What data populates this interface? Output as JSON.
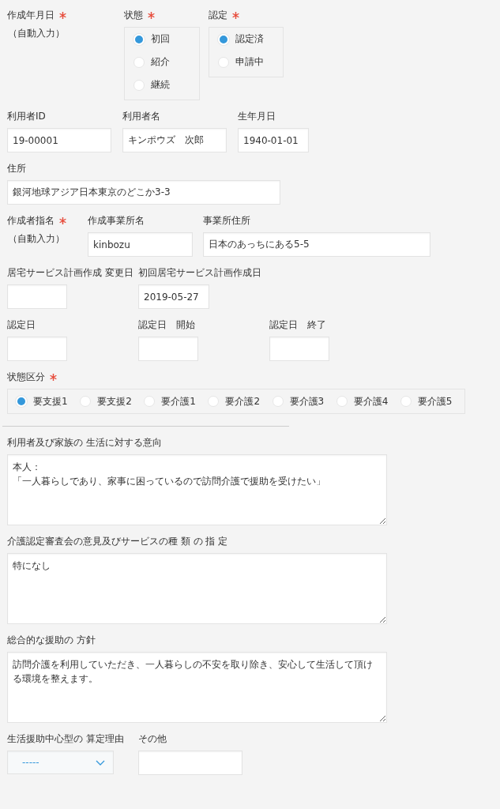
{
  "rows": [
    {
      "fields": [
        {
          "kind": "auto",
          "label": "作成年月日",
          "required": true,
          "value": "（自動入力）"
        },
        {
          "kind": "radio",
          "label": "状態",
          "required": true,
          "options": [
            {
              "label": "初回",
              "selected": true
            },
            {
              "label": "紹介",
              "selected": false
            },
            {
              "label": "継続",
              "selected": false
            }
          ]
        },
        {
          "kind": "radio",
          "label": "認定",
          "required": true,
          "options": [
            {
              "label": "認定済",
              "selected": true
            },
            {
              "label": "申請中",
              "selected": false
            }
          ]
        }
      ]
    },
    {
      "fields": [
        {
          "kind": "text",
          "label": "利用者ID",
          "required": false,
          "value": "19-00001"
        },
        {
          "kind": "text",
          "label": "利用者名",
          "required": false,
          "value": "キンポウズ　次郎"
        },
        {
          "kind": "text",
          "label": "生年月日",
          "required": false,
          "value": "1940-01-01"
        }
      ]
    },
    {
      "fields": [
        {
          "kind": "text",
          "label": "住所",
          "required": false,
          "value": "銀河地球アジア日本東京のどこか3-3"
        }
      ]
    },
    {
      "fields": [
        {
          "kind": "auto",
          "label": "作成者指名",
          "required": true,
          "value": "（自動入力）"
        },
        {
          "kind": "text",
          "label": "作成事業所名",
          "required": false,
          "value": "kinbozu"
        },
        {
          "kind": "text",
          "label": "事業所住所",
          "required": false,
          "value": "日本のあっちにある5-5"
        }
      ]
    },
    {
      "fields": [
        {
          "kind": "text",
          "label": "居宅サービス計画作成 変更日",
          "required": false
        },
        {
          "kind": "text",
          "label": "初回居宅サービス計画作成日",
          "required": false,
          "value": "2019-05-27"
        }
      ]
    },
    {
      "fields": [
        {
          "kind": "text",
          "label": "認定日",
          "required": false
        },
        {
          "kind": "text",
          "label": "認定日　開始",
          "required": false
        },
        {
          "kind": "text",
          "label": "認定日　終了",
          "required": false
        }
      ]
    },
    {
      "fields": [
        {
          "kind": "radio-inline",
          "label": "状態区分",
          "required": true,
          "options": [
            {
              "label": "要支援1",
              "selected": true
            },
            {
              "label": "要支援2",
              "selected": false
            },
            {
              "label": "要介護1",
              "selected": false
            },
            {
              "label": "要介護2",
              "selected": false
            },
            {
              "label": "要介護3",
              "selected": false
            },
            {
              "label": "要介護4",
              "selected": false
            },
            {
              "label": "要介護5",
              "selected": false
            }
          ]
        }
      ]
    },
    {
      "fields": [
        {
          "kind": "divider"
        }
      ]
    },
    {
      "fields": [
        {
          "kind": "textarea",
          "label": "利用者及び家族の 生活に対する意向",
          "required": false,
          "lines": [
            "本人：",
            "「一人暮らしであり、家事に困っているので訪問介護で援助を受けたい」"
          ]
        }
      ]
    },
    {
      "fields": [
        {
          "kind": "textarea",
          "label": "介護認定審査会の意見及びサービスの種 類 の 指 定",
          "required": false,
          "value": "特になし"
        }
      ]
    },
    {
      "fields": [
        {
          "kind": "textarea",
          "label": "総合的な援助の 方針",
          "required": false,
          "value": "訪問介護を利用していただき、一人暮らしの不安を取り除き、安心して生活して頂ける環境を整えます。"
        }
      ]
    },
    {
      "fields": [
        {
          "kind": "select",
          "label": "生活援助中心型の 算定理由",
          "required": false,
          "value": "-----"
        },
        {
          "kind": "text",
          "label": "その他",
          "required": false
        }
      ]
    }
  ]
}
